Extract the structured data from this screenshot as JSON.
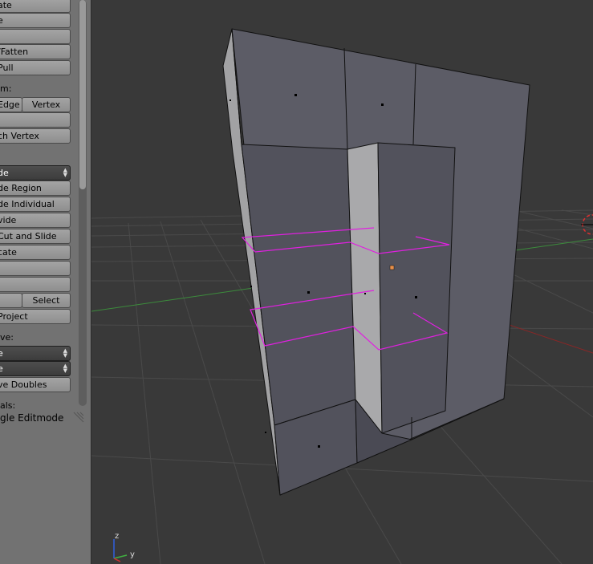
{
  "toolshelf": {
    "btn_rotate": "ate",
    "btn_scale": "e",
    "btn_blank1": "",
    "btn_shrink_fatten": "/Fatten",
    "btn_push_pull": "Pull",
    "label_remove": "m:",
    "btn_edge": "Edge",
    "btn_vertex": "Vertex",
    "btn_blank2": "",
    "btn_patch_vertex": "ch Vertex",
    "dd_extrude": "de",
    "btn_extrude_region": "de Region",
    "btn_extrude_individual": "de Individual",
    "btn_subdivide": "vide",
    "btn_loop_cut": "Cut and Slide",
    "btn_duplicate": "cate",
    "btn_blank3": "",
    "btn_blank4": ".",
    "btn_select_left": "",
    "btn_select": "Select",
    "btn_knife_project": "Project",
    "label_remove2": "ve:",
    "dd_remove1": "e",
    "dd_remove2": "e",
    "btn_remove_doubles": "ve Doubles",
    "label_normals": "als:",
    "toggle_editmode": "gle Editmode"
  },
  "viewport": {
    "axis_z": "z",
    "axis_y": "y"
  },
  "colors": {
    "viewport_bg": "#393939",
    "panel_bg": "#727272",
    "face": "#5c5c66",
    "selection": "#e020e0",
    "x_axis": "#8a2626",
    "y_axis": "#3c8c3c"
  }
}
